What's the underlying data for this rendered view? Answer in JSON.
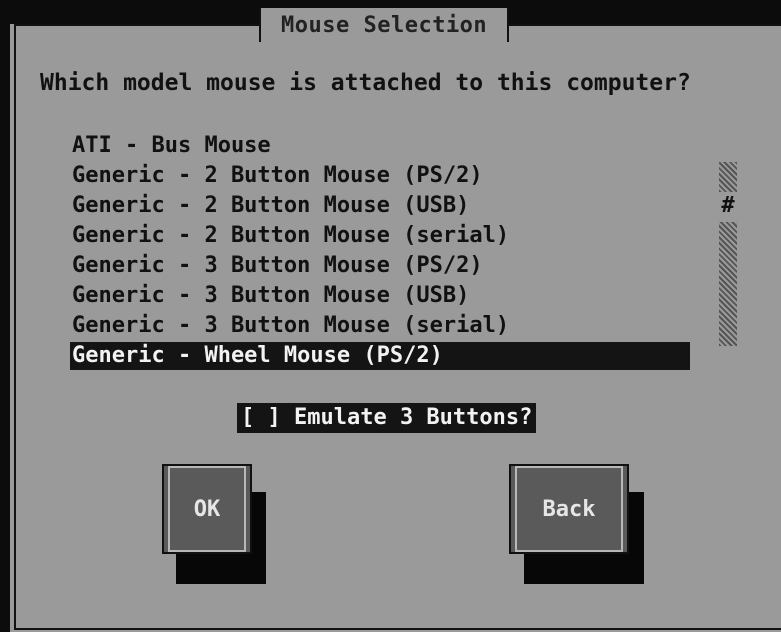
{
  "dialog": {
    "title": "Mouse Selection",
    "question": "Which model mouse is attached to this computer?"
  },
  "mouse_list": {
    "items": [
      "ATI - Bus Mouse",
      "Generic - 2 Button Mouse (PS/2)",
      "Generic - 2 Button Mouse (USB)",
      "Generic - 2 Button Mouse (serial)",
      "Generic - 3 Button Mouse (PS/2)",
      "Generic - 3 Button Mouse (USB)",
      "Generic - 3 Button Mouse (serial)",
      "Generic - Wheel Mouse (PS/2)"
    ],
    "selected_index": 7
  },
  "scrollbar": {
    "thumb_glyph": "#"
  },
  "emulate": {
    "label": "[ ] Emulate 3 Buttons?"
  },
  "buttons": {
    "ok_label": "OK",
    "back_label": "Back"
  }
}
